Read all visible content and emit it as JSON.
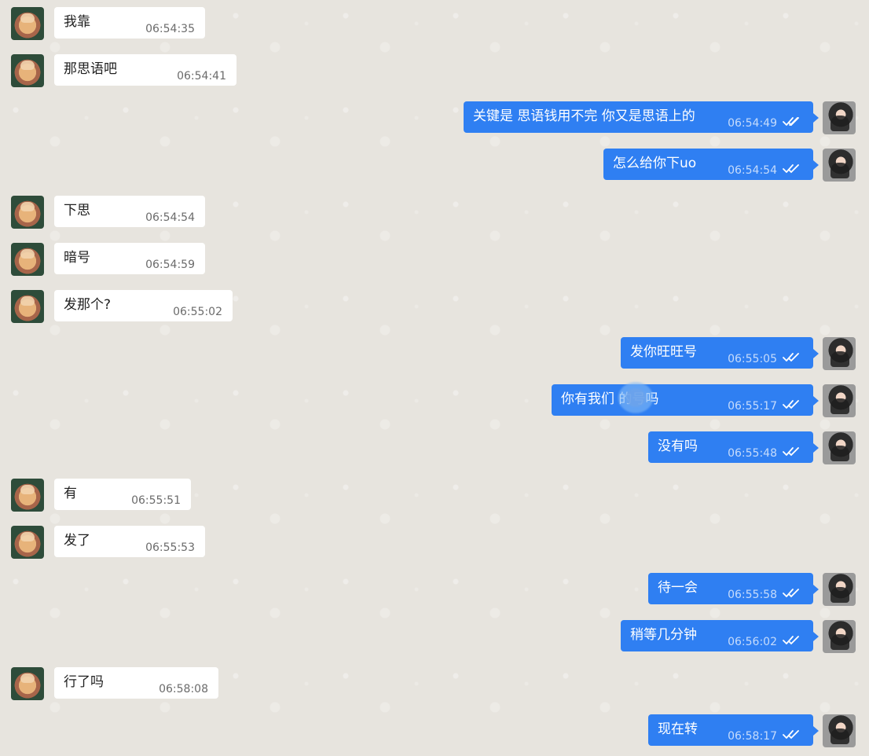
{
  "messages": [
    {
      "dir": "in",
      "text": "我靠",
      "time": "06:54:35"
    },
    {
      "dir": "in",
      "text": "那思语吧",
      "time": "06:54:41"
    },
    {
      "dir": "out",
      "text": "关键是 思语钱用不完 你又是思语上的",
      "time": "06:54:49"
    },
    {
      "dir": "out",
      "text": "怎么给你下uo",
      "time": "06:54:54"
    },
    {
      "dir": "in",
      "text": "下思",
      "time": "06:54:54"
    },
    {
      "dir": "in",
      "text": "暗号",
      "time": "06:54:59"
    },
    {
      "dir": "in",
      "text": "发那个?",
      "time": "06:55:02"
    },
    {
      "dir": "out",
      "text": "发你旺旺号",
      "time": "06:55:05"
    },
    {
      "dir": "out",
      "text": "你有我们        的号吗",
      "time": "06:55:17",
      "redacted": true
    },
    {
      "dir": "out",
      "text": "没有吗",
      "time": "06:55:48"
    },
    {
      "dir": "in",
      "text": "有",
      "time": "06:55:51"
    },
    {
      "dir": "in",
      "text": "发了",
      "time": "06:55:53"
    },
    {
      "dir": "out",
      "text": "待一会",
      "time": "06:55:58"
    },
    {
      "dir": "out",
      "text": "稍等几分钟",
      "time": "06:56:02"
    },
    {
      "dir": "in",
      "text": "行了吗",
      "time": "06:58:08"
    },
    {
      "dir": "out",
      "text": "现在转",
      "time": "06:58:17"
    }
  ],
  "icons": {
    "read_receipt": "double-check-icon",
    "incoming_avatar": "corgi-avatar",
    "outgoing_avatar": "woman-avatar"
  },
  "colors": {
    "background": "#e7e4de",
    "incoming_bubble": "#ffffff",
    "outgoing_bubble": "#2f7ff2"
  }
}
